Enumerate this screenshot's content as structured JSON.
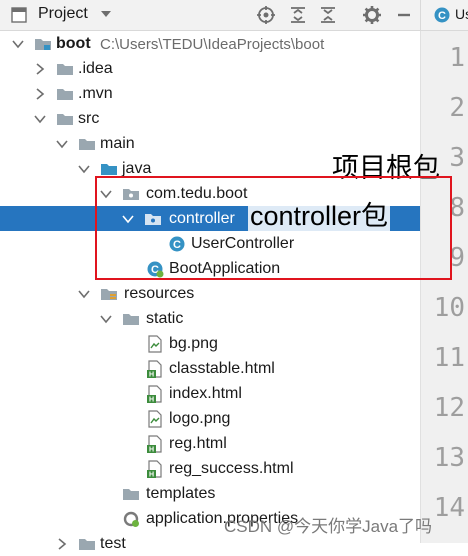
{
  "toolbar": {
    "title": "Project",
    "icons": [
      "project-icon",
      "chevron-down-icon",
      "locate-icon",
      "expand-all-icon",
      "collapse-all-icon",
      "settings-icon",
      "minimize-icon"
    ]
  },
  "editor": {
    "tab_label": "Us",
    "line_numbers": [
      "1",
      "2",
      "3",
      "8",
      "9",
      "10",
      "11",
      "12",
      "13",
      "14"
    ]
  },
  "tree": {
    "root": {
      "label": "boot",
      "path": "C:\\Users\\TEDU\\IdeaProjects\\boot"
    },
    "idea": ".idea",
    "mvn": ".mvn",
    "src": "src",
    "main": "main",
    "java": "java",
    "package": "com.tedu.boot",
    "controller": "controller",
    "user_controller": "UserController",
    "boot_application": "BootApplication",
    "resources": "resources",
    "static": "static",
    "files": [
      "bg.png",
      "classtable.html",
      "index.html",
      "logo.png",
      "reg.html",
      "reg_success.html"
    ],
    "templates": "templates",
    "app_props": "application.properties",
    "test": "test"
  },
  "annotations": {
    "root_package": "项目根包",
    "controller_package": "controller包"
  },
  "watermark": "CSDN @今天你学Java了吗",
  "colors": {
    "selection": "#2675bf",
    "annotation_border": "#e0141e",
    "folder": "#9aa7b0",
    "java_class": "#3592c4",
    "html_badge": "#3c8c3c"
  }
}
